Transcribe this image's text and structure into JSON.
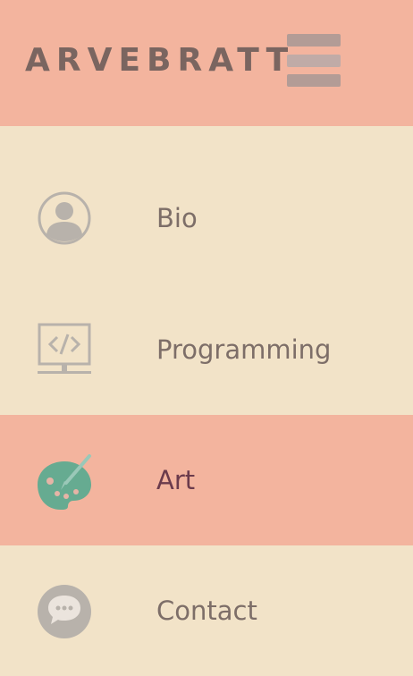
{
  "header": {
    "brand": "ARVEBRATT",
    "menu_icon": "hamburger-menu-icon"
  },
  "menu": {
    "items": [
      {
        "label": "Bio",
        "icon": "user-circle-icon",
        "active": false
      },
      {
        "label": "Programming",
        "icon": "code-monitor-icon",
        "active": false
      },
      {
        "label": "Art",
        "icon": "paint-palette-icon",
        "active": true
      },
      {
        "label": "Contact",
        "icon": "chat-bubble-icon",
        "active": false
      }
    ]
  },
  "colors": {
    "header_bg": "#f3b49e",
    "page_bg": "#f2e3c8",
    "active_bg": "#f3b49e",
    "text": "#7d6e68",
    "active_text": "#6b3b4c",
    "icon_gray": "#b8b2ab",
    "palette_green": "#66ab91"
  }
}
